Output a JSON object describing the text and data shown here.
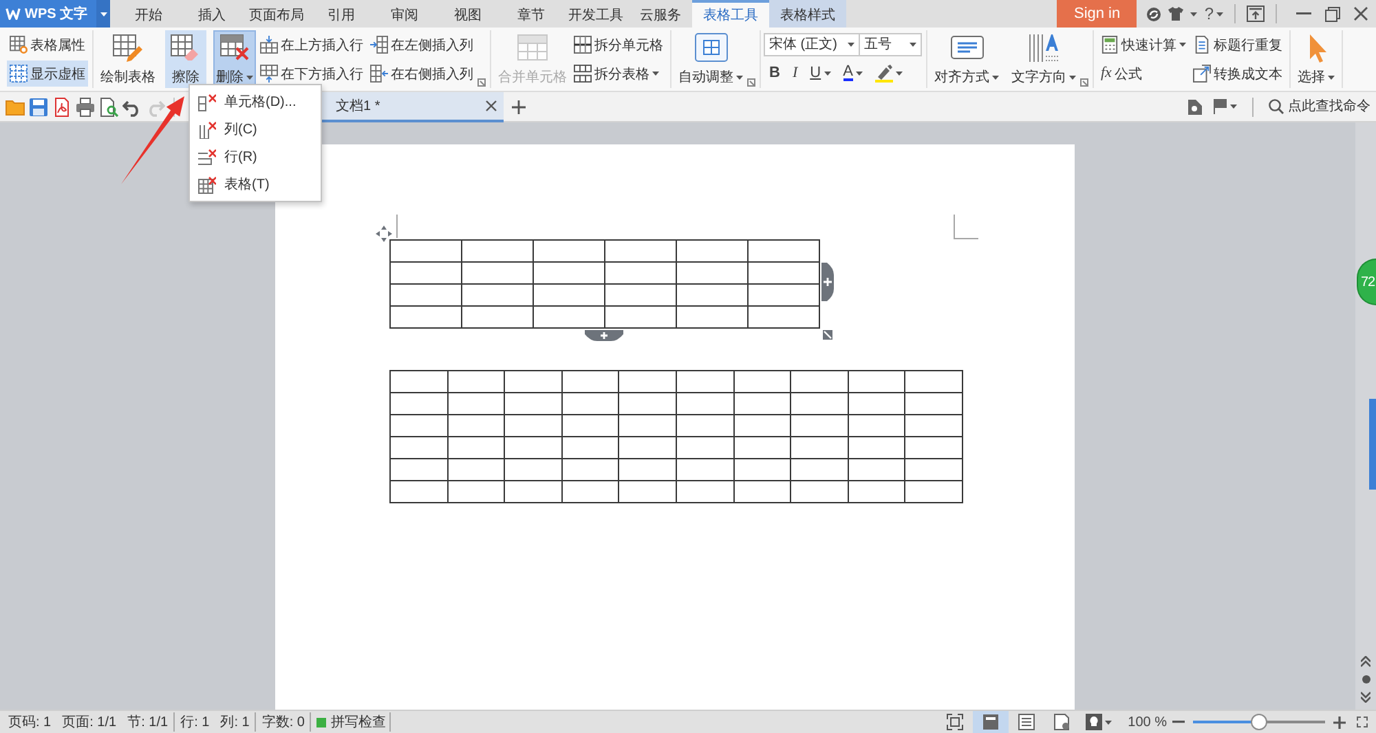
{
  "app_menu": {
    "label": "WPS 文字"
  },
  "tabs": [
    {
      "label": "开始",
      "kind": "main",
      "selected": false
    },
    {
      "label": "插入",
      "kind": "main",
      "selected": false
    },
    {
      "label": "页面布局",
      "kind": "main",
      "selected": false
    },
    {
      "label": "引用",
      "kind": "main",
      "selected": false
    },
    {
      "label": "审阅",
      "kind": "main",
      "selected": false
    },
    {
      "label": "视图",
      "kind": "main",
      "selected": false
    },
    {
      "label": "章节",
      "kind": "main",
      "selected": false
    },
    {
      "label": "开发工具",
      "kind": "main",
      "selected": false
    },
    {
      "label": "云服务",
      "kind": "main",
      "selected": false
    },
    {
      "label": "表格工具",
      "kind": "context",
      "selected": true
    },
    {
      "label": "表格样式",
      "kind": "context",
      "selected": false
    }
  ],
  "title_bar": {
    "sign_in": "Sign in",
    "help": "?"
  },
  "ribbon": {
    "groups": [
      {
        "stacks": [
          [
            {
              "kind": "properties",
              "label": "表格属性",
              "on": false,
              "disabled": false,
              "expanded": false
            },
            {
              "kind": "gridlines",
              "label": "显示虚框",
              "on": true,
              "disabled": false,
              "expanded": false
            }
          ]
        ]
      },
      {
        "large": [
          {
            "kind": "draw",
            "label": "绘制表格",
            "on": false,
            "disabled": false,
            "expanded": false
          },
          {
            "kind": "erase",
            "label": "擦除",
            "on": true,
            "disabled": false,
            "expanded": false
          },
          {
            "kind": "delete",
            "label": "删除",
            "caret": true,
            "on": true,
            "disabled": false,
            "expanded": true
          }
        ],
        "stacks": [
          [
            {
              "kind": "insert-above",
              "label": "在上方插入行",
              "on": false,
              "disabled": false,
              "expanded": false
            },
            {
              "kind": "insert-below",
              "label": "在下方插入行",
              "on": false,
              "disabled": false,
              "expanded": false
            }
          ],
          [
            {
              "kind": "insert-left",
              "label": "在左侧插入列",
              "on": false,
              "disabled": false,
              "expanded": false
            },
            {
              "kind": "insert-right",
              "label": "在右侧插入列",
              "on": false,
              "disabled": false,
              "expanded": false
            }
          ]
        ],
        "launcher": true
      },
      {
        "large": [
          {
            "kind": "merge",
            "label": "合并单元格",
            "on": false,
            "disabled": true,
            "expanded": false
          }
        ],
        "stacks": [
          [
            {
              "kind": "split-cells",
              "label": "拆分单元格",
              "on": false,
              "disabled": false,
              "expanded": false
            },
            {
              "kind": "split-table",
              "label": "拆分表格",
              "caret": true,
              "on": false,
              "disabled": false,
              "expanded": false
            }
          ]
        ]
      },
      {
        "large": [
          {
            "kind": "autofit",
            "label": "自动调整",
            "caret": true,
            "on": false,
            "disabled": false,
            "expanded": false
          }
        ],
        "launcher": true
      },
      {
        "font": {
          "family": "宋体 (正文)",
          "size": "五号"
        },
        "format": [
          {
            "kind": "bold",
            "label": "B"
          },
          {
            "kind": "italic",
            "label": "I"
          },
          {
            "kind": "underline",
            "label": "U",
            "caret": true
          },
          {
            "kind": "font-color",
            "label": "A",
            "caret": true
          },
          {
            "kind": "highlight",
            "caret": true
          }
        ]
      },
      {
        "large": [
          {
            "kind": "align",
            "label": "对齐方式",
            "caret": true,
            "on": false,
            "disabled": false,
            "expanded": false
          },
          {
            "kind": "text-direction",
            "label": "文字方向",
            "caret": true,
            "on": false,
            "disabled": false,
            "expanded": false
          }
        ],
        "launcher": true
      },
      {
        "stacks": [
          [
            {
              "kind": "calculate",
              "label": "快速计算",
              "caret": true,
              "on": false,
              "disabled": false,
              "expanded": false
            },
            {
              "kind": "formula",
              "label": "公式",
              "glyph": "fx",
              "on": false,
              "disabled": false,
              "expanded": false
            }
          ],
          [
            {
              "kind": "repeat-header",
              "label": "标题行重复",
              "on": false,
              "disabled": false,
              "expanded": false
            },
            {
              "kind": "to-text",
              "label": "转换成文本",
              "on": false,
              "disabled": false,
              "expanded": false
            }
          ]
        ]
      },
      {
        "large": [
          {
            "kind": "select",
            "label": "选择",
            "caret": true,
            "on": false,
            "disabled": false,
            "expanded": false
          }
        ]
      }
    ]
  },
  "quick_access": [
    {
      "kind": "open",
      "disabled": false
    },
    {
      "kind": "save",
      "disabled": false
    },
    {
      "kind": "pdf",
      "disabled": false
    },
    {
      "kind": "print",
      "disabled": false
    },
    {
      "kind": "preview",
      "disabled": false
    },
    {
      "kind": "undo",
      "disabled": false
    },
    {
      "kind": "redo",
      "disabled": true
    }
  ],
  "document_tabs": [
    {
      "label": "文档1 *",
      "selected": true
    }
  ],
  "command_search": {
    "placeholder": "点此查找命令"
  },
  "delete_menu": {
    "items": [
      {
        "kind": "cell",
        "label": "单元格(D)..."
      },
      {
        "kind": "column",
        "label": "列(C)"
      },
      {
        "kind": "row",
        "label": "行(R)"
      },
      {
        "kind": "table",
        "label": "表格(T)"
      }
    ]
  },
  "document": {
    "tables": [
      {
        "active": true,
        "rows": [
          {
            "cells": [
              {},
              {},
              {},
              {},
              {},
              {}
            ]
          },
          {
            "cells": [
              {},
              {},
              {},
              {},
              {},
              {}
            ]
          },
          {
            "cells": [
              {},
              {},
              {},
              {},
              {},
              {}
            ]
          },
          {
            "cells": [
              {},
              {},
              {},
              {},
              {},
              {}
            ]
          }
        ]
      },
      {
        "rows": [
          {
            "cells": [
              {},
              {},
              {},
              {},
              {},
              {},
              {},
              {},
              {},
              {}
            ]
          },
          {
            "cells": [
              {},
              {},
              {},
              {},
              {},
              {},
              {},
              {},
              {},
              {}
            ]
          },
          {
            "cells": [
              {},
              {},
              {},
              {},
              {},
              {},
              {},
              {},
              {},
              {}
            ]
          },
          {
            "cells": [
              {},
              {},
              {},
              {},
              {},
              {},
              {},
              {},
              {},
              {}
            ]
          },
          {
            "cells": [
              {},
              {},
              {},
              {},
              {},
              {},
              {},
              {},
              {},
              {}
            ]
          },
          {
            "cells": [
              {},
              {},
              {},
              {},
              {},
              {},
              {},
              {},
              {},
              {}
            ]
          }
        ]
      }
    ]
  },
  "side_badge": {
    "label": "72"
  },
  "status_bar": {
    "sections": [
      {
        "items": [
          "页码: 1",
          "页面: 1/1",
          "节: 1/1"
        ]
      },
      {
        "items": [
          "行: 1",
          "列: 1"
        ]
      },
      {
        "items": [
          "字数: 0"
        ]
      }
    ],
    "spell_check": {
      "label": "拼写检查",
      "on": true
    },
    "views": [
      {
        "kind": "fullscreen",
        "selected": false
      },
      {
        "kind": "page",
        "selected": true
      },
      {
        "kind": "outline",
        "selected": false
      },
      {
        "kind": "web",
        "selected": false
      }
    ],
    "zoom": {
      "reading": "100 %",
      "level": 0.5
    }
  }
}
